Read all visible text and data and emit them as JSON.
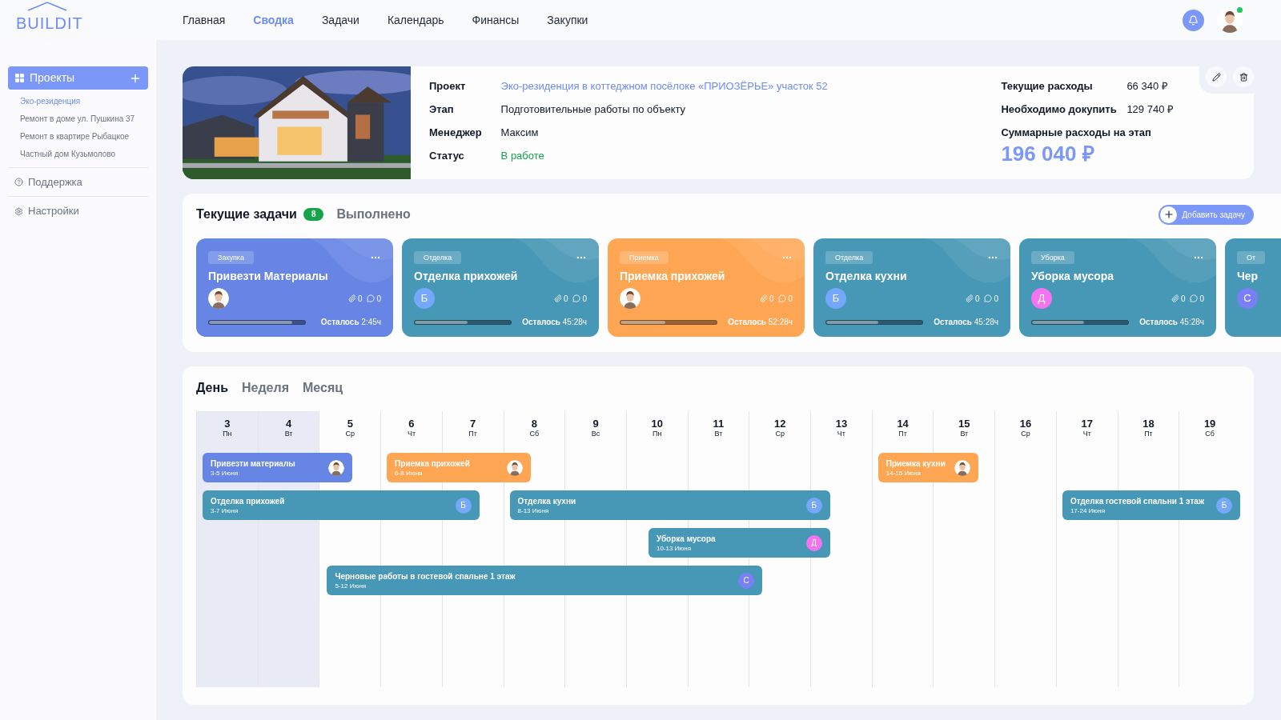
{
  "logo": "BUILDIT",
  "nav": [
    {
      "label": "Главная",
      "selected": false
    },
    {
      "label": "Сводка",
      "selected": true
    },
    {
      "label": "Задачи",
      "selected": false
    },
    {
      "label": "Календарь",
      "selected": false
    },
    {
      "label": "Финансы",
      "selected": false
    },
    {
      "label": "Закупки",
      "selected": false
    }
  ],
  "user": {
    "online": true
  },
  "sidebar": {
    "projects": {
      "label": "Проекты",
      "items": [
        {
          "label": "Эко-резиденция",
          "selected": true
        },
        {
          "label": "Ремонт в доме ул. Пушкина 37",
          "selected": false
        },
        {
          "label": "Ремонт в квартире Рыбацкое",
          "selected": false
        },
        {
          "label": "Частный дом Кузьмолово",
          "selected": false
        }
      ]
    },
    "links": [
      {
        "kind": "support",
        "label": "Поддержка"
      },
      {
        "kind": "settings",
        "label": "Настройки"
      }
    ]
  },
  "project": {
    "fields": [
      {
        "label": "Проект",
        "value": "Эко-резиденция в коттеджном посёлоке «ПРИОЗЁРЬЕ» участок 52",
        "kind": "link"
      },
      {
        "label": "Этап",
        "value": "Подготовительные работы по объекту",
        "kind": "text"
      },
      {
        "label": "Менеджер",
        "value": "Максим",
        "kind": "text"
      },
      {
        "label": "Статус",
        "value": "В работе",
        "kind": "status"
      }
    ],
    "costs": [
      {
        "label": "Текущие расходы",
        "value": "66 340 ₽"
      },
      {
        "label": "Необходимо докупить",
        "value": "129 740 ₽"
      }
    ],
    "total_label": "Суммарные расходы на этап",
    "total": "196 040 ₽"
  },
  "tasks": {
    "tabs": [
      {
        "label": "Текущие задачи",
        "count": "8",
        "selected": true
      },
      {
        "label": "Выполнено",
        "selected": false
      }
    ],
    "add_button": "Добавить задачу",
    "cards": [
      {
        "tag": "Закупка",
        "title": "Привезти Материалы",
        "color": "#6685e4",
        "attachments": "0",
        "comments": "0",
        "level": 0.87,
        "remaining": "**Осталось** 2:45ч"
      },
      {
        "tag": "Отделка",
        "title": "Отделка прихожей",
        "color": "#4797b6",
        "avatar": {
          "kind": "letter",
          "letter": "Б",
          "color": "#75a8fb"
        },
        "attachments": "0",
        "comments": "0",
        "level": 0.55,
        "remaining": "**Осталось** 45:28ч"
      },
      {
        "tag": "Приемка",
        "title": "Приемка прихожей",
        "color": "#ffa654",
        "attachments": "0",
        "comments": "0",
        "level": 0.47,
        "remaining": "**Осталось** 52:28ч"
      },
      {
        "tag": "Отделка",
        "title": "Отделка кухни",
        "color": "#4797b6",
        "avatar": {
          "kind": "letter",
          "letter": "Б",
          "color": "#75a8fb"
        },
        "attachments": "0",
        "comments": "0",
        "level": 0.54,
        "remaining": "**Осталось** 45:28ч"
      },
      {
        "tag": "Уборка",
        "title": "Уборка мусора",
        "color": "#4797b6",
        "avatar": {
          "kind": "letter",
          "letter": "Д",
          "color": "#f274f0"
        },
        "attachments": "0",
        "comments": "0",
        "level": 0.54,
        "remaining": "**Осталось** 45:28ч"
      },
      {
        "tag": "От",
        "title": "Чер",
        "color": "#4797b6",
        "avatar": {
          "kind": "letter",
          "letter": "С",
          "color": "#7a7ff5"
        }
      }
    ]
  },
  "schedule": {
    "views": [
      {
        "label": "День",
        "selected": true
      },
      {
        "label": "Неделя",
        "selected": false
      },
      {
        "label": "Месяц",
        "selected": false
      }
    ],
    "days": [
      {
        "day": "3",
        "weekday": "Пн",
        "selected": true
      },
      {
        "day": "4",
        "weekday": "Вт",
        "selected": true
      },
      {
        "day": "5",
        "weekday": "Ср",
        "selected": false
      },
      {
        "day": "6",
        "weekday": "Чт",
        "selected": false
      },
      {
        "day": "7",
        "weekday": "Пт",
        "selected": false
      },
      {
        "day": "8",
        "weekday": "Сб",
        "selected": false
      },
      {
        "day": "9",
        "weekday": "Вс",
        "selected": false
      },
      {
        "day": "10",
        "weekday": "Пн",
        "selected": false
      },
      {
        "day": "11",
        "weekday": "Вт",
        "selected": false
      },
      {
        "day": "12",
        "weekday": "Ср",
        "selected": false
      },
      {
        "day": "13",
        "weekday": "Чт",
        "selected": false
      },
      {
        "day": "14",
        "weekday": "Пт",
        "selected": false
      },
      {
        "day": "15",
        "weekday": "Вт",
        "selected": false
      },
      {
        "day": "16",
        "weekday": "Ср",
        "selected": false
      },
      {
        "day": "17",
        "weekday": "Чт",
        "selected": false
      },
      {
        "day": "18",
        "weekday": "Пт",
        "selected": false
      },
      {
        "day": "19",
        "weekday": "Сб",
        "selected": false
      }
    ],
    "events": [
      {
        "title": "Привезти материалы",
        "dates": "3-5 Июня",
        "color": "#6685e4"
      },
      {
        "title": "Приемка прихожей",
        "dates": "6-8 Июня",
        "color": "#ffa654"
      },
      {
        "title": "Приемка кухни",
        "dates": "14-15 Июня",
        "color": "#ffa654"
      },
      {
        "title": "Отделка прихожей",
        "dates": "3-7 Июня",
        "color": "#4797b6",
        "avatar": {
          "kind": "letter",
          "letter": "Б",
          "color": "#75a8fb"
        }
      },
      {
        "title": "Отделка кухни",
        "dates": "8-13 Июня",
        "color": "#4797b6",
        "avatar": {
          "kind": "letter",
          "letter": "Б",
          "color": "#75a8fb"
        }
      },
      {
        "title": "Отделка гостевой спальни 1 этаж",
        "dates": "17-24 Июня",
        "color": "#4797b6",
        "avatar": {
          "kind": "letter",
          "letter": "Б",
          "color": "#75a8fb"
        }
      },
      {
        "title": "Уборка мусора",
        "dates": "10-13 Июня",
        "color": "#4797b6",
        "avatar": {
          "kind": "letter",
          "letter": "Д",
          "color": "#f274f0"
        }
      },
      {
        "title": "Черновые работы в гостевой спальне 1 этаж",
        "dates": "5-12 Июня",
        "color": "#4797b6",
        "avatar": {
          "kind": "letter",
          "letter": "С",
          "color": "#7a7ff5"
        }
      }
    ]
  }
}
